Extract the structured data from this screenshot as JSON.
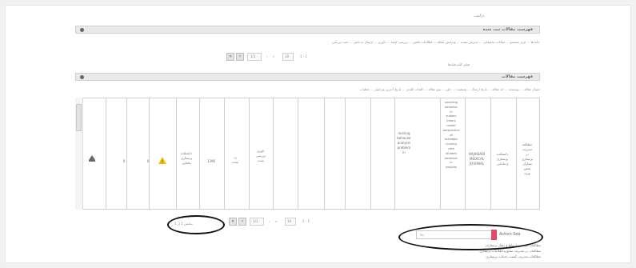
{
  "top_link": "بازگشت",
  "panel1": {
    "title": "فهرست مقالات ثبت شده",
    "nav_text": "خانه ها ... فرم جستجو ... مقالات تحقیقاتی ... پذیرش نشده ... ویرایش مقاله ... اطلاعات ناقص ... بررسی اولیه ... داوری ... ارسال به ناشر ... تحت بررسی"
  },
  "pager1": {
    "first": "«",
    "prev": "‹",
    "page": "1/1",
    "next": "›",
    "last": "»",
    "per_page": "10",
    "info": "1 - 1"
  },
  "panel2": {
    "subhead": "فیلتر کلیه فیلدها",
    "title": "فهرست مقالات",
    "nav_text": "عنوان مقاله ... نویسنده ... کد مقاله ... تاریخ ارسال ... وضعیت ... داور ... نوع مقاله ... کلمات کلیدی ... تاریخ آخرین ویرایش ... عملیات"
  },
  "table": {
    "cells": [
      {
        "text": "مطالعه\nمدیریت\nدر\nپرستاری\nبیماران\nبخش\nویژه"
      },
      {
        "text": "دانشکده\nپرستاری\nو مامایی"
      },
      {
        "text": "HAJIABADI\nMEDICAL\nJOURNAL"
      },
      {
        "text": "smarting\nbehavior\nin\nsubject\ntheory\nmodel\nperspective\nof\nmanager\nnursing\ncare\nstudent\nbehavior\nin\nhospital"
      },
      {
        "text": ""
      },
      {
        "text": "nursing\nbehavior\nanalysis\nproblem\nin"
      },
      {
        "text": ""
      },
      {
        "text": ""
      },
      {
        "text": "داوری\nبررسی\nشده"
      },
      {
        "text": "رد\nشده"
      },
      {
        "text": "1396"
      },
      {
        "text": "دانشکده\nپرستاری\nمامایی"
      },
      {
        "text": "!"
      },
      {
        "text": "0"
      },
      {
        "text": "0"
      },
      {
        "text": ""
      }
    ]
  },
  "pager2": {
    "first": "«",
    "prev": "‹",
    "page": "1/1",
    "next": "›",
    "last": "»",
    "per_page": "10",
    "info": "1 - 1",
    "record_count": "نمایش 1 از 1"
  },
  "search": {
    "label": "Action Sea",
    "value": "su"
  },
  "results": [
    "مطالعات در نحوه ارتباط و رفتار پرستاران",
    "مطالعات در مدیریت منابع و اطلاعات پرستاری",
    "مطالعات مدیریت کیفیت خدمات پرستاری"
  ],
  "colors": {
    "accent": "#e24a6a",
    "warning": "#f2c200",
    "highlight_oval": "#111111"
  }
}
